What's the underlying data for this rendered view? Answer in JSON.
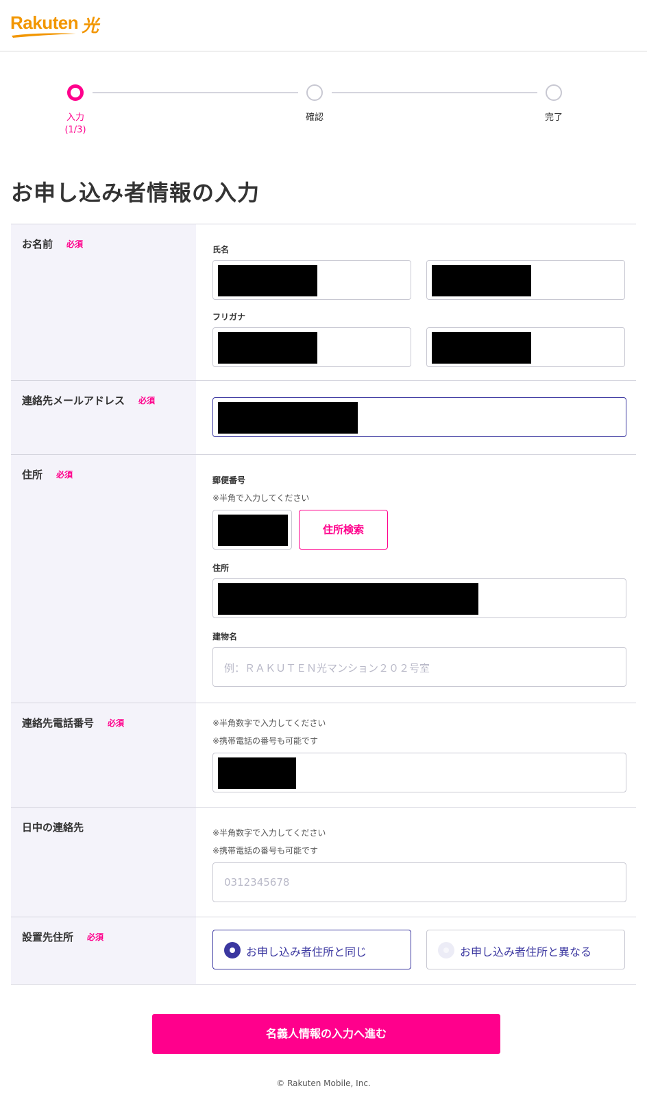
{
  "brand": {
    "logo_text": "Rakuten",
    "logo_kanji": "光",
    "color": "#f29600"
  },
  "stepper": {
    "steps": [
      {
        "label": "入力",
        "sub": "(1/3)",
        "active": true
      },
      {
        "label": "確認",
        "sub": "",
        "active": false
      },
      {
        "label": "完了",
        "sub": "",
        "active": false
      }
    ]
  },
  "page_title": "お申し込み者情報の入力",
  "required_badge": "必須",
  "sections": {
    "name": {
      "label": "お名前",
      "full_name_label": "氏名",
      "kana_label": "フリガナ"
    },
    "email": {
      "label": "連絡先メールアドレス"
    },
    "address": {
      "label": "住所",
      "postal_label": "郵便番号",
      "postal_note": "※半角で入力してください",
      "search_button": "住所検索",
      "address_label": "住所",
      "building_label": "建物名",
      "building_placeholder": "例：ＲＡＫＵＴＥＮ光マンション２０２号室"
    },
    "phone": {
      "label": "連絡先電話番号",
      "note1": "※半角数字で入力してください",
      "note2": "※携帯電話の番号も可能です"
    },
    "daytime": {
      "label": "日中の連絡先",
      "note1": "※半角数字で入力してください",
      "note2": "※携帯電話の番号も可能です",
      "placeholder": "0312345678"
    },
    "install": {
      "label": "設置先住所",
      "option_same": "お申し込み者住所と同じ",
      "option_diff": "お申し込み者住所と異なる",
      "selected": "option_same"
    }
  },
  "submit_label": "名義人情報の入力へ進む",
  "footer": "© Rakuten Mobile, Inc.",
  "colors": {
    "accent": "#ff008c",
    "primary": "#3b37a0",
    "head_bg": "#f4f3fa"
  }
}
